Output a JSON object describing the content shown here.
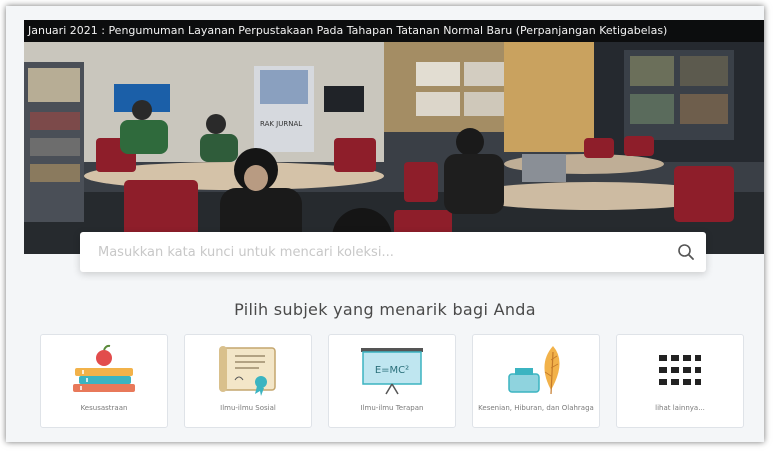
{
  "announcement": "Januari 2021 : Pengumuman Layanan Perpustakaan Pada Tahapan Tatanan Normal Baru (Perpanjangan Ketigabelas)",
  "search": {
    "placeholder": "Masukkan kata kunci untuk mencari koleksi..."
  },
  "section_title": "Pilih subjek yang menarik bagi Anda",
  "subjects": [
    {
      "label": "Kesusastraan",
      "icon": "books-apple-icon"
    },
    {
      "label": "Ilmu-ilmu Sosial",
      "icon": "certificate-scroll-icon"
    },
    {
      "label": "Ilmu-ilmu Terapan",
      "icon": "whiteboard-formula-icon"
    },
    {
      "label": "Kesenian, Hiburan, dan Olahraga",
      "icon": "ink-feather-icon"
    },
    {
      "label": "lihat lainnya...",
      "icon": "grid-icon"
    }
  ],
  "board_text": "E=MC²",
  "photo_signs": {
    "magazine_rack": "RAK JURNAL"
  },
  "colors": {
    "accent": "#3bb4c1",
    "chair_red": "#8e1e2a",
    "table": "#d9c6ad"
  }
}
